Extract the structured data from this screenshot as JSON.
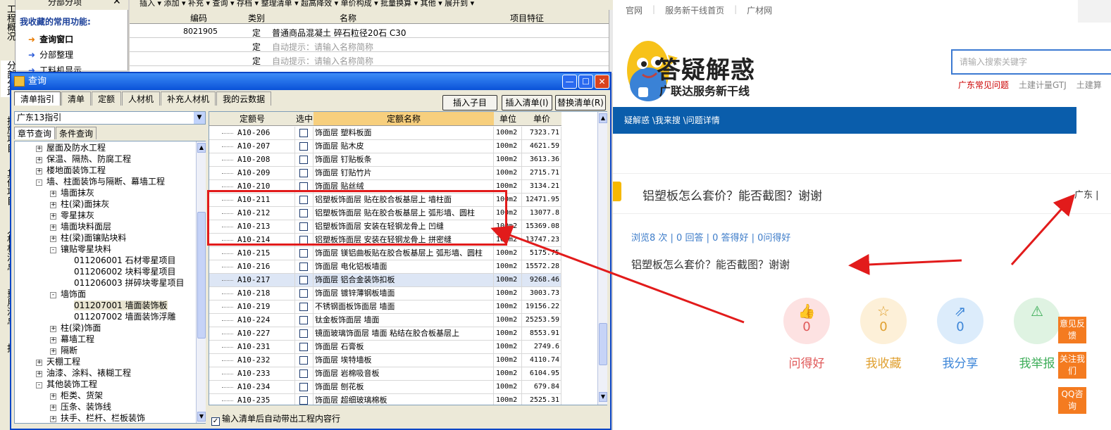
{
  "app": {
    "vertical_tabs": [
      "工程概况",
      "分部分项",
      "措施项目",
      "其他项目",
      "人材机汇总",
      "费用汇总",
      "报"
    ],
    "fav_header": "分部分项",
    "fav_title": "我收藏的常用功能:",
    "fav_items": [
      "查询窗口",
      "分部整理",
      "工料机显示"
    ],
    "toolbar": "插入 ▾  添加 ▾  补充 ▾  查询 ▾  存档 ▾   整理清单 ▾  超高降效 ▾  单价构成 ▾  批量换算 ▾  其他 ▾  展开到 ▾",
    "bg_table": {
      "headers": [
        "编码",
        "类别",
        "名称",
        "项目特征"
      ],
      "rows": [
        {
          "code": "8021905",
          "type": "定",
          "name": "普通商品混凝土 碎石粒径20石 C30"
        },
        {
          "code": "",
          "type": "定",
          "name": "自动提示：请输入名称简称"
        },
        {
          "code": "",
          "type": "定",
          "name": "自动提示：请输入名称简称"
        }
      ]
    }
  },
  "dialog": {
    "title": "查询",
    "tabs": [
      "清单指引",
      "清单",
      "定额",
      "人材机",
      "补充人材机",
      "我的云数据"
    ],
    "buttons": {
      "insert_child": "插入子目",
      "insert_list": "插入清单(I)",
      "replace_list": "替换清单(R)"
    },
    "combo_value": "广东13指引",
    "subtabs": [
      "章节查询",
      "条件查询"
    ],
    "tree": [
      {
        "label": "屋面及防水工程",
        "level": 1,
        "box": "+"
      },
      {
        "label": "保温、隔热、防腐工程",
        "level": 1,
        "box": "+"
      },
      {
        "label": "楼地面装饰工程",
        "level": 1,
        "box": "+"
      },
      {
        "label": "墙、柱面装饰与隔断、幕墙工程",
        "level": 1,
        "box": "-"
      },
      {
        "label": "墙面抹灰",
        "level": 2,
        "box": "+"
      },
      {
        "label": "柱(梁)面抹灰",
        "level": 2,
        "box": "+"
      },
      {
        "label": "零星抹灰",
        "level": 2,
        "box": "+"
      },
      {
        "label": "墙面块料面层",
        "level": 2,
        "box": "+"
      },
      {
        "label": "柱(梁)面镶贴块料",
        "level": 2,
        "box": "+"
      },
      {
        "label": "镶贴零星块料",
        "level": 2,
        "box": "-"
      },
      {
        "label": "011206001   石材零星项目",
        "level": 3,
        "box": ""
      },
      {
        "label": "011206002   块料零星项目",
        "level": 3,
        "box": ""
      },
      {
        "label": "011206003   拼碎块零星项目",
        "level": 3,
        "box": ""
      },
      {
        "label": "墙饰面",
        "level": 2,
        "box": "-"
      },
      {
        "label": "011207001   墙面装饰板",
        "level": 3,
        "box": "",
        "selected": true
      },
      {
        "label": "011207002   墙面装饰浮雕",
        "level": 3,
        "box": ""
      },
      {
        "label": "柱(梁)饰面",
        "level": 2,
        "box": "+"
      },
      {
        "label": "幕墙工程",
        "level": 2,
        "box": "+"
      },
      {
        "label": "隔断",
        "level": 2,
        "box": "+"
      },
      {
        "label": "天棚工程",
        "level": 1,
        "box": "+"
      },
      {
        "label": "油漆、涂料、裱糊工程",
        "level": 1,
        "box": "+"
      },
      {
        "label": "其他装饰工程",
        "level": 1,
        "box": "-"
      },
      {
        "label": "柜类、货架",
        "level": 2,
        "box": "+"
      },
      {
        "label": "压条、装饰线",
        "level": 2,
        "box": "+"
      },
      {
        "label": "扶手、栏杆、栏板装饰",
        "level": 2,
        "box": "+"
      }
    ],
    "grid_headers": [
      "定额号",
      "选中",
      "定额名称",
      "单位",
      "单价"
    ],
    "grid_rows": [
      {
        "code": "A10-206",
        "name": "饰面层 塑料板面",
        "unit": "100m2",
        "price": "7323.71"
      },
      {
        "code": "A10-207",
        "name": "饰面层 贴木皮",
        "unit": "100m2",
        "price": "4621.59"
      },
      {
        "code": "A10-208",
        "name": "饰面层 钉贴板条",
        "unit": "100m2",
        "price": "3613.36"
      },
      {
        "code": "A10-209",
        "name": "饰面层 钉贴竹片",
        "unit": "100m2",
        "price": "2715.71"
      },
      {
        "code": "A10-210",
        "name": "饰面层 贴丝绒",
        "unit": "100m2",
        "price": "3134.21"
      },
      {
        "code": "A10-211",
        "name": "铝塑板饰面层 贴在胶合板基层上 墙柱面",
        "unit": "100m2",
        "price": "12471.95"
      },
      {
        "code": "A10-212",
        "name": "铝塑板饰面层 贴在胶合板基层上 弧形墙、圆柱",
        "unit": "100m2",
        "price": "13077.8"
      },
      {
        "code": "A10-213",
        "name": "铝塑板饰面层 安装在轻钢龙骨上 凹缝",
        "unit": "100m2",
        "price": "15369.08"
      },
      {
        "code": "A10-214",
        "name": "铝塑板饰面层 安装在轻钢龙骨上 拼密缝",
        "unit": "100m2",
        "price": "13747.23"
      },
      {
        "code": "A10-215",
        "name": "饰面层 镁铝曲板贴在胶合板基层上 弧形墙、圆柱",
        "unit": "100m2",
        "price": "5175.75"
      },
      {
        "code": "A10-216",
        "name": "饰面层 电化铝板墙面",
        "unit": "100m2",
        "price": "15572.28"
      },
      {
        "code": "A10-217",
        "name": "饰面层 铝合金装饰扣板",
        "unit": "100m2",
        "price": "9268.46"
      },
      {
        "code": "A10-218",
        "name": "饰面层 镀锌薄钢板墙面",
        "unit": "100m2",
        "price": "3003.73"
      },
      {
        "code": "A10-219",
        "name": "不锈钢面板饰面层 墙面",
        "unit": "100m2",
        "price": "19156.22"
      },
      {
        "code": "A10-224",
        "name": "钛金板饰面层 墙面",
        "unit": "100m2",
        "price": "25253.59"
      },
      {
        "code": "A10-227",
        "name": "镜面玻璃饰面层 墙面 粘结在胶合板基层上",
        "unit": "100m2",
        "price": "8553.91"
      },
      {
        "code": "A10-231",
        "name": "饰面层 石膏板",
        "unit": "100m2",
        "price": "2749.6"
      },
      {
        "code": "A10-232",
        "name": "饰面层 埃特墙板",
        "unit": "100m2",
        "price": "4110.74"
      },
      {
        "code": "A10-233",
        "name": "饰面层 岩棉吸音板",
        "unit": "100m2",
        "price": "6104.95"
      },
      {
        "code": "A10-234",
        "name": "饰面层 刨花板",
        "unit": "100m2",
        "price": "679.84"
      },
      {
        "code": "A10-235",
        "name": "饰面层 超细玻璃棉板",
        "unit": "100m2",
        "price": "2525.31"
      }
    ],
    "auto_check_label": "输入清单后自动带出工程内容行"
  },
  "web": {
    "topnav": [
      "官网",
      "服务新干线首页",
      "广材网"
    ],
    "logo_title": "答疑解惑",
    "logo_sub": "广联达服务新干线",
    "search_placeholder": "请输入搜索关键字",
    "hotlinks": [
      "广东常见问题",
      "土建计量GTJ",
      "土建算"
    ],
    "breadcrumb": "疑解惑 \\我来搜 \\问题详情",
    "question_title": "铝塑板怎么套价？能否截图？谢谢",
    "question_region": "广东 |",
    "stats": "浏览8 次 | 0 回答 | 0 答得好 | 0问得好",
    "question_body": "铝塑板怎么套价？能否截图？谢谢",
    "actions": [
      {
        "label": "问得好",
        "count": "0",
        "icon": "thumb-up-icon",
        "glyph": "👍",
        "color": "#e05a5a",
        "bg": "#fde2e2"
      },
      {
        "label": "我收藏",
        "count": "0",
        "icon": "star-icon",
        "glyph": "☆",
        "color": "#e0a030",
        "bg": "#fdf0d8"
      },
      {
        "label": "我分享",
        "count": "0",
        "icon": "share-icon",
        "glyph": "⇗",
        "color": "#3d86d8",
        "bg": "#dcecfb"
      },
      {
        "label": "我举报",
        "count": "",
        "icon": "warning-icon",
        "glyph": "⚠",
        "color": "#3fae5a",
        "bg": "#dff3e2"
      }
    ],
    "side_buttons": [
      "意见反馈",
      "关注我们",
      "QQ咨询"
    ]
  }
}
